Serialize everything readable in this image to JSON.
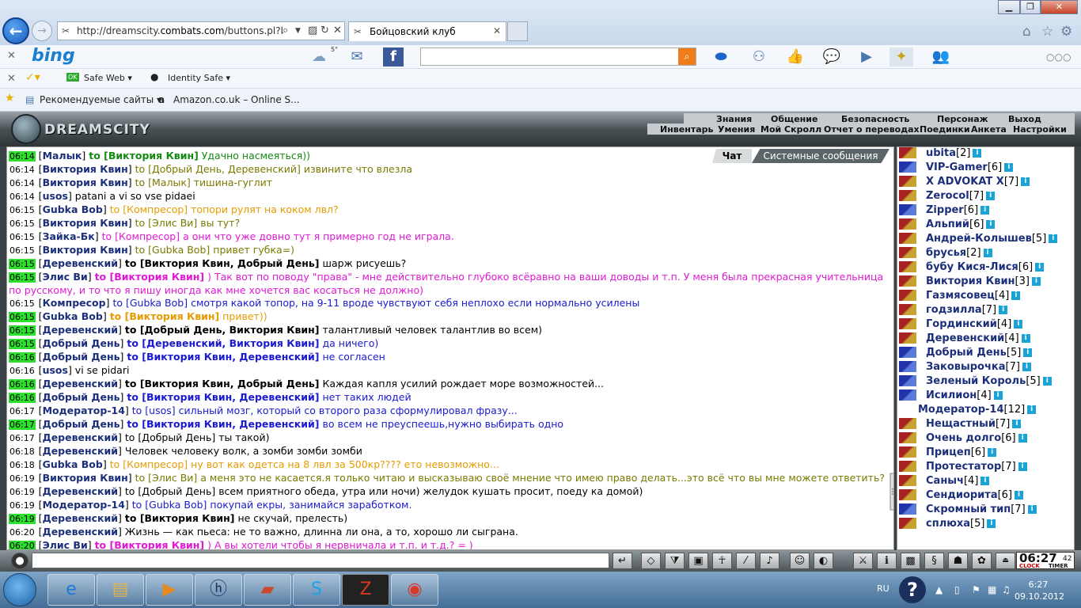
{
  "browser": {
    "url_prefix": "http://dreamscity.",
    "url_domain": "combats.com",
    "url_rest": "/buttons.pl?batt",
    "tab_title": "Бойцовский клуб",
    "window_controls": {
      "min": "▁",
      "max": "❐",
      "close": "✕"
    }
  },
  "bing_bar": {
    "logo": "bing",
    "weather": "5°"
  },
  "toolbar2": {
    "safe_web": "Safe Web",
    "identity_safe": "Identity Safe"
  },
  "favorites": {
    "recommended": "Рекомендуемые сайты",
    "amazon": "Amazon.co.uk – Online S..."
  },
  "game": {
    "logo": "DREAMSCITY",
    "top_menu": [
      "Знания",
      "Общение",
      "Безопасность",
      "Персонаж",
      "Выход"
    ],
    "sub_menu": [
      "Инвентарь",
      "Умения",
      "Мой Скролл",
      "Отчет о переводах",
      "Поединки",
      "Анкета",
      "Настройки"
    ],
    "chat_tabs": {
      "chat": "Чат",
      "system": "Системные сообщения"
    },
    "chat": [
      {
        "time": "06:14",
        "g": true,
        "nick": "Малык",
        "to": "to [Виктория Квин]",
        "msg": "Удачно насмеяться))",
        "color": "c-g",
        "tobold": true
      },
      {
        "time": "06:14",
        "g": false,
        "nick": "Виктория Квин",
        "to": "to [Добрый День, Деревенский]",
        "msg": "извините что влезла",
        "color": "c-ol",
        "tobold": false
      },
      {
        "time": "06:14",
        "g": false,
        "nick": "Виктория Квин",
        "to": "to [Малык]",
        "msg": "тишина-гуглит",
        "color": "c-ol",
        "tobold": false
      },
      {
        "time": "06:14",
        "g": false,
        "nick": "usos",
        "to": "",
        "msg": "patani a vi so vse pidaei",
        "color": "c-k",
        "tobold": false
      },
      {
        "time": "06:15",
        "g": false,
        "nick": "Gubka Bob",
        "to": "to [Компресор]",
        "msg": "топори рулят на коком лвл?",
        "color": "c-o",
        "tobold": false
      },
      {
        "time": "06:15",
        "g": false,
        "nick": "Виктория Квин",
        "to": "to [Элис Ви]",
        "msg": "вы тут?",
        "color": "c-ol",
        "tobold": false
      },
      {
        "time": "06:15",
        "g": false,
        "nick": "Зайка-Бк",
        "to": "to [Компресор]",
        "msg": "а они что уже довно тут я примерно год не играла.",
        "color": "c-m",
        "tobold": false
      },
      {
        "time": "06:15",
        "g": false,
        "nick": "Виктория Квин",
        "to": "to [Gubka Bob]",
        "msg": "привет губка=)",
        "color": "c-ol",
        "tobold": false
      },
      {
        "time": "06:15",
        "g": true,
        "nick": "Деревенский",
        "to": "to [Виктория Квин, Добрый День]",
        "msg": "шарж рисуешь?",
        "color": "c-k",
        "tobold": true
      },
      {
        "time": "06:15",
        "g": true,
        "nick": "Элис Ви",
        "to": "to [Виктория Квин]",
        "msg": ") Так вот по поводу \"права\" - мне действительно глубоко всёравно на ваши доводы и т.п. У меня была прекрасная учительница по русскому, и то что я пишу иногда как мне хочется вас косаться не должно)",
        "color": "c-m",
        "tobold": true
      },
      {
        "time": "06:15",
        "g": false,
        "nick": "Компресор",
        "to": "to [Gubka Bob]",
        "msg": "смотря какой топор, на 9-11 вроде чувствуют себя неплохо если нормально усилены",
        "color": "c-b",
        "tobold": false
      },
      {
        "time": "06:15",
        "g": true,
        "nick": "Gubka Bob",
        "to": "to [Виктория Квин]",
        "msg": "привет))",
        "color": "c-o",
        "tobold": true
      },
      {
        "time": "06:15",
        "g": true,
        "nick": "Деревенский",
        "to": "to [Добрый День, Виктория Квин]",
        "msg": "талантливый человек талантлив во всем)",
        "color": "c-k",
        "tobold": true
      },
      {
        "time": "06:15",
        "g": true,
        "nick": "Добрый День",
        "to": "to [Деревенский, Виктория Квин]",
        "msg": "да ничего)",
        "color": "c-b",
        "tobold": true
      },
      {
        "time": "06:16",
        "g": true,
        "nick": "Добрый День",
        "to": "to [Виктория Квин, Деревенский]",
        "msg": "не согласен",
        "color": "c-b",
        "tobold": true
      },
      {
        "time": "06:16",
        "g": false,
        "nick": "usos",
        "to": "",
        "msg": "vi se pidari",
        "color": "c-k",
        "tobold": false
      },
      {
        "time": "06:16",
        "g": true,
        "nick": "Деревенский",
        "to": "to [Виктория Квин, Добрый День]",
        "msg": "Каждая капля усилий рождает море возможностей...",
        "color": "c-k",
        "tobold": true
      },
      {
        "time": "06:16",
        "g": true,
        "nick": "Добрый День",
        "to": "to [Виктория Квин, Деревенский]",
        "msg": "нет таких людей",
        "color": "c-b",
        "tobold": true
      },
      {
        "time": "06:17",
        "g": false,
        "nick": "Модератор-14",
        "to": "to [usos]",
        "msg": "сильный мозг, который со второго раза сформулировал фразу...",
        "color": "c-b",
        "tobold": false
      },
      {
        "time": "06:17",
        "g": true,
        "nick": "Добрый День",
        "to": "to [Виктория Квин, Деревенский]",
        "msg": "во всем не преуспеешь,нужно выбирать одно",
        "color": "c-b",
        "tobold": true
      },
      {
        "time": "06:17",
        "g": false,
        "nick": "Деревенский",
        "to": "to [Добрый День]",
        "msg": "ты такой)",
        "color": "c-k",
        "tobold": false
      },
      {
        "time": "06:18",
        "g": false,
        "nick": "Деревенский",
        "to": "",
        "msg": "Человек человеку волк, а зомби зомби зомби",
        "color": "c-k",
        "tobold": false
      },
      {
        "time": "06:18",
        "g": false,
        "nick": "Gubka Bob",
        "to": "to [Компресор]",
        "msg": "ну вот как одетса на 8 лвл за 500кр???? ето невозможно...",
        "color": "c-o",
        "tobold": false
      },
      {
        "time": "06:19",
        "g": false,
        "nick": "Виктория Квин",
        "to": "to [Элис Ви]",
        "msg": "а меня это не касается.я только читаю и высказываю своё мнение что имею право делать...это всё что вы мне можете ответить?",
        "color": "c-ol",
        "tobold": false
      },
      {
        "time": "06:19",
        "g": false,
        "nick": "Деревенский",
        "to": "to [Добрый День]",
        "msg": "всем приятного обеда, утра или ночи) желудок кушать просит, поеду ка домой)",
        "color": "c-k",
        "tobold": false
      },
      {
        "time": "06:19",
        "g": false,
        "nick": "Модератор-14",
        "to": "to [Gubka Bob]",
        "msg": "покупай екры, занимайся заработком.",
        "color": "c-b",
        "tobold": false
      },
      {
        "time": "06:19",
        "g": true,
        "nick": "Деревенский",
        "to": "to [Виктория Квин]",
        "msg": "не скучай, прелесть)",
        "color": "c-k",
        "tobold": true
      },
      {
        "time": "06:20",
        "g": false,
        "nick": "Деревенский",
        "to": "",
        "msg": "Жизнь — как пьеса: не то важно, длинна ли она, а то, хорошо ли сыграна.",
        "color": "c-k",
        "tobold": false
      },
      {
        "time": "06:20",
        "g": true,
        "nick": "Элис Ви",
        "to": "to [Виктория Квин]",
        "msg": ") А вы хотели чтобы я нервничала и т.п. и т.д.? = )",
        "color": "c-m",
        "tobold": true
      }
    ],
    "users": [
      {
        "name": "ubita",
        "lvl": "[2]",
        "k": "a"
      },
      {
        "name": "VIP-Gamer",
        "lvl": "[6]",
        "k": "b"
      },
      {
        "name": "X ADVOKAT X",
        "lvl": "[7]",
        "k": "a"
      },
      {
        "name": "Zerocol",
        "lvl": "[7]",
        "k": "a"
      },
      {
        "name": "Zipper",
        "lvl": "[6]",
        "k": "b"
      },
      {
        "name": "Альпий",
        "lvl": "[6]",
        "k": "a"
      },
      {
        "name": "Андрей-Колышев",
        "lvl": "[5]",
        "k": "a"
      },
      {
        "name": "брусья",
        "lvl": "[2]",
        "k": "a"
      },
      {
        "name": "бубу Кися-Лися",
        "lvl": "[6]",
        "k": "a"
      },
      {
        "name": "Виктория Квин",
        "lvl": "[3]",
        "k": "a"
      },
      {
        "name": "Газмясовец",
        "lvl": "[4]",
        "k": "a"
      },
      {
        "name": "годзилла",
        "lvl": "[7]",
        "k": "a"
      },
      {
        "name": "Гординский",
        "lvl": "[4]",
        "k": "a"
      },
      {
        "name": "Деревенский",
        "lvl": "[4]",
        "k": "a"
      },
      {
        "name": "Добрый День",
        "lvl": "[5]",
        "k": "b"
      },
      {
        "name": "Заковырочка",
        "lvl": "[7]",
        "k": "b"
      },
      {
        "name": "Зеленый Король",
        "lvl": "[5]",
        "k": "b"
      },
      {
        "name": "Исилион",
        "lvl": "[4]",
        "k": "b"
      },
      {
        "name": "Модератор-14",
        "lvl": "[12]",
        "k": "a",
        "indent": true
      },
      {
        "name": "Нещастный",
        "lvl": "[7]",
        "k": "a"
      },
      {
        "name": "Очень долго",
        "lvl": "[6]",
        "k": "a"
      },
      {
        "name": "Прицеп",
        "lvl": "[6]",
        "k": "a"
      },
      {
        "name": "Протестатор",
        "lvl": "[7]",
        "k": "a"
      },
      {
        "name": "Саныч",
        "lvl": "[4]",
        "k": "a"
      },
      {
        "name": "Сендиорита",
        "lvl": "[6]",
        "k": "a"
      },
      {
        "name": "Скромный тип",
        "lvl": "[7]",
        "k": "b"
      },
      {
        "name": "сплюха",
        "lvl": "[5]",
        "k": "a"
      }
    ],
    "clock": {
      "time": "06:27",
      "sec": "42",
      "label1": "CLOCK",
      "label2": "TIMER"
    }
  },
  "taskbar": {
    "lang": "RU",
    "time": "6:27",
    "date": "09.10.2012"
  }
}
